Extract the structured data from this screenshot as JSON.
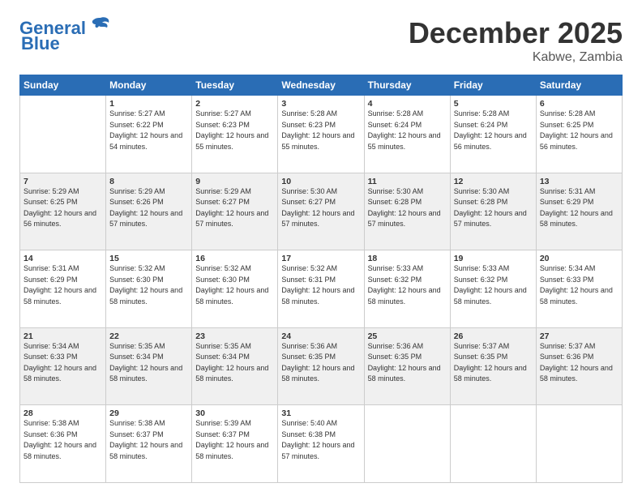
{
  "header": {
    "logo_line1": "General",
    "logo_line2": "Blue",
    "month": "December 2025",
    "location": "Kabwe, Zambia"
  },
  "weekdays": [
    "Sunday",
    "Monday",
    "Tuesday",
    "Wednesday",
    "Thursday",
    "Friday",
    "Saturday"
  ],
  "weeks": [
    [
      {
        "day": "",
        "sunrise": "",
        "sunset": "",
        "daylight": ""
      },
      {
        "day": "1",
        "sunrise": "Sunrise: 5:27 AM",
        "sunset": "Sunset: 6:22 PM",
        "daylight": "Daylight: 12 hours and 54 minutes."
      },
      {
        "day": "2",
        "sunrise": "Sunrise: 5:27 AM",
        "sunset": "Sunset: 6:23 PM",
        "daylight": "Daylight: 12 hours and 55 minutes."
      },
      {
        "day": "3",
        "sunrise": "Sunrise: 5:28 AM",
        "sunset": "Sunset: 6:23 PM",
        "daylight": "Daylight: 12 hours and 55 minutes."
      },
      {
        "day": "4",
        "sunrise": "Sunrise: 5:28 AM",
        "sunset": "Sunset: 6:24 PM",
        "daylight": "Daylight: 12 hours and 55 minutes."
      },
      {
        "day": "5",
        "sunrise": "Sunrise: 5:28 AM",
        "sunset": "Sunset: 6:24 PM",
        "daylight": "Daylight: 12 hours and 56 minutes."
      },
      {
        "day": "6",
        "sunrise": "Sunrise: 5:28 AM",
        "sunset": "Sunset: 6:25 PM",
        "daylight": "Daylight: 12 hours and 56 minutes."
      }
    ],
    [
      {
        "day": "7",
        "sunrise": "Sunrise: 5:29 AM",
        "sunset": "Sunset: 6:25 PM",
        "daylight": "Daylight: 12 hours and 56 minutes."
      },
      {
        "day": "8",
        "sunrise": "Sunrise: 5:29 AM",
        "sunset": "Sunset: 6:26 PM",
        "daylight": "Daylight: 12 hours and 57 minutes."
      },
      {
        "day": "9",
        "sunrise": "Sunrise: 5:29 AM",
        "sunset": "Sunset: 6:27 PM",
        "daylight": "Daylight: 12 hours and 57 minutes."
      },
      {
        "day": "10",
        "sunrise": "Sunrise: 5:30 AM",
        "sunset": "Sunset: 6:27 PM",
        "daylight": "Daylight: 12 hours and 57 minutes."
      },
      {
        "day": "11",
        "sunrise": "Sunrise: 5:30 AM",
        "sunset": "Sunset: 6:28 PM",
        "daylight": "Daylight: 12 hours and 57 minutes."
      },
      {
        "day": "12",
        "sunrise": "Sunrise: 5:30 AM",
        "sunset": "Sunset: 6:28 PM",
        "daylight": "Daylight: 12 hours and 57 minutes."
      },
      {
        "day": "13",
        "sunrise": "Sunrise: 5:31 AM",
        "sunset": "Sunset: 6:29 PM",
        "daylight": "Daylight: 12 hours and 58 minutes."
      }
    ],
    [
      {
        "day": "14",
        "sunrise": "Sunrise: 5:31 AM",
        "sunset": "Sunset: 6:29 PM",
        "daylight": "Daylight: 12 hours and 58 minutes."
      },
      {
        "day": "15",
        "sunrise": "Sunrise: 5:32 AM",
        "sunset": "Sunset: 6:30 PM",
        "daylight": "Daylight: 12 hours and 58 minutes."
      },
      {
        "day": "16",
        "sunrise": "Sunrise: 5:32 AM",
        "sunset": "Sunset: 6:30 PM",
        "daylight": "Daylight: 12 hours and 58 minutes."
      },
      {
        "day": "17",
        "sunrise": "Sunrise: 5:32 AM",
        "sunset": "Sunset: 6:31 PM",
        "daylight": "Daylight: 12 hours and 58 minutes."
      },
      {
        "day": "18",
        "sunrise": "Sunrise: 5:33 AM",
        "sunset": "Sunset: 6:32 PM",
        "daylight": "Daylight: 12 hours and 58 minutes."
      },
      {
        "day": "19",
        "sunrise": "Sunrise: 5:33 AM",
        "sunset": "Sunset: 6:32 PM",
        "daylight": "Daylight: 12 hours and 58 minutes."
      },
      {
        "day": "20",
        "sunrise": "Sunrise: 5:34 AM",
        "sunset": "Sunset: 6:33 PM",
        "daylight": "Daylight: 12 hours and 58 minutes."
      }
    ],
    [
      {
        "day": "21",
        "sunrise": "Sunrise: 5:34 AM",
        "sunset": "Sunset: 6:33 PM",
        "daylight": "Daylight: 12 hours and 58 minutes."
      },
      {
        "day": "22",
        "sunrise": "Sunrise: 5:35 AM",
        "sunset": "Sunset: 6:34 PM",
        "daylight": "Daylight: 12 hours and 58 minutes."
      },
      {
        "day": "23",
        "sunrise": "Sunrise: 5:35 AM",
        "sunset": "Sunset: 6:34 PM",
        "daylight": "Daylight: 12 hours and 58 minutes."
      },
      {
        "day": "24",
        "sunrise": "Sunrise: 5:36 AM",
        "sunset": "Sunset: 6:35 PM",
        "daylight": "Daylight: 12 hours and 58 minutes."
      },
      {
        "day": "25",
        "sunrise": "Sunrise: 5:36 AM",
        "sunset": "Sunset: 6:35 PM",
        "daylight": "Daylight: 12 hours and 58 minutes."
      },
      {
        "day": "26",
        "sunrise": "Sunrise: 5:37 AM",
        "sunset": "Sunset: 6:35 PM",
        "daylight": "Daylight: 12 hours and 58 minutes."
      },
      {
        "day": "27",
        "sunrise": "Sunrise: 5:37 AM",
        "sunset": "Sunset: 6:36 PM",
        "daylight": "Daylight: 12 hours and 58 minutes."
      }
    ],
    [
      {
        "day": "28",
        "sunrise": "Sunrise: 5:38 AM",
        "sunset": "Sunset: 6:36 PM",
        "daylight": "Daylight: 12 hours and 58 minutes."
      },
      {
        "day": "29",
        "sunrise": "Sunrise: 5:38 AM",
        "sunset": "Sunset: 6:37 PM",
        "daylight": "Daylight: 12 hours and 58 minutes."
      },
      {
        "day": "30",
        "sunrise": "Sunrise: 5:39 AM",
        "sunset": "Sunset: 6:37 PM",
        "daylight": "Daylight: 12 hours and 58 minutes."
      },
      {
        "day": "31",
        "sunrise": "Sunrise: 5:40 AM",
        "sunset": "Sunset: 6:38 PM",
        "daylight": "Daylight: 12 hours and 57 minutes."
      },
      {
        "day": "",
        "sunrise": "",
        "sunset": "",
        "daylight": ""
      },
      {
        "day": "",
        "sunrise": "",
        "sunset": "",
        "daylight": ""
      },
      {
        "day": "",
        "sunrise": "",
        "sunset": "",
        "daylight": ""
      }
    ]
  ]
}
